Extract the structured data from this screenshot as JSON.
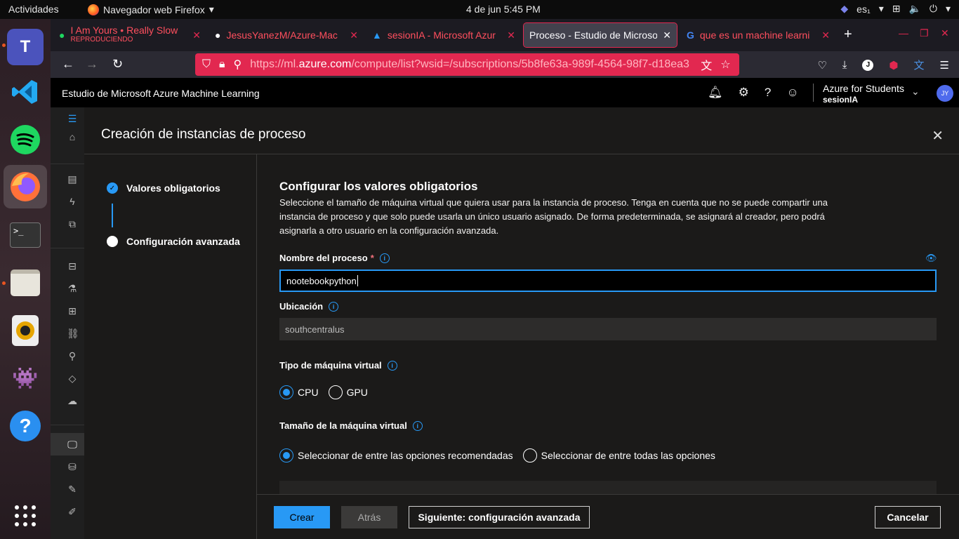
{
  "os": {
    "activities": "Actividades",
    "app_menu": "Navegador web Firefox",
    "clock": "4 de jun  5:45 PM",
    "keyboard_layout": "es₁"
  },
  "browser": {
    "tabs": [
      {
        "title": "I Am Yours • Really Slow",
        "subtitle": "REPRODUCIENDO"
      },
      {
        "title": "JesusYanezM/Azure-Mac"
      },
      {
        "title": "sesionIA - Microsoft Azur"
      },
      {
        "title": "Proceso - Estudio de Microso"
      },
      {
        "title": "que es un machine learni"
      }
    ],
    "url_prefix": "https://ml.",
    "url_domain": "azure.com",
    "url_rest": "/compute/list?wsid=/subscriptions/5b8fe63a-989f-4564-98f7-d18ea3"
  },
  "azure": {
    "brand": "Estudio de Microsoft Azure Machine Learning",
    "subscription": "Azure for Students",
    "workspace": "sesionIA",
    "avatar_initials": "JY"
  },
  "panel": {
    "title": "Creación de instancias de proceso",
    "steps": [
      {
        "label": "Valores obligatorios",
        "state": "done"
      },
      {
        "label": "Configuración avanzada",
        "state": "pending"
      }
    ],
    "heading": "Configurar los valores obligatorios",
    "description": "Seleccione el tamaño de máquina virtual que quiera usar para la instancia de proceso. Tenga en cuenta que no se puede compartir una instancia de proceso y que solo puede usarla un único usuario asignado. De forma predeterminada, se asignará al creador, pero podrá asignarla a otro usuario en la configuración avanzada.",
    "process_name_label": "Nombre del proceso",
    "process_name_required": "*",
    "process_name_value": "nootebookpython",
    "location_label": "Ubicación",
    "location_value": "southcentralus",
    "vm_type_label": "Tipo de máquina virtual",
    "vm_type_options": [
      "CPU",
      "GPU"
    ],
    "vm_type_selected": "CPU",
    "vm_size_label": "Tamaño de la máquina virtual",
    "vm_size_options": [
      "Seleccionar de entre las opciones recomendadas",
      "Seleccionar de entre todas las opciones"
    ],
    "vm_size_selected": "Seleccionar de entre las opciones recomendadas"
  },
  "footer": {
    "create": "Crear",
    "back": "Atrás",
    "next": "Siguiente: configuración avanzada",
    "cancel": "Cancelar"
  },
  "colors": {
    "accent": "#2899f5",
    "private_url_bar": "#e22850"
  }
}
